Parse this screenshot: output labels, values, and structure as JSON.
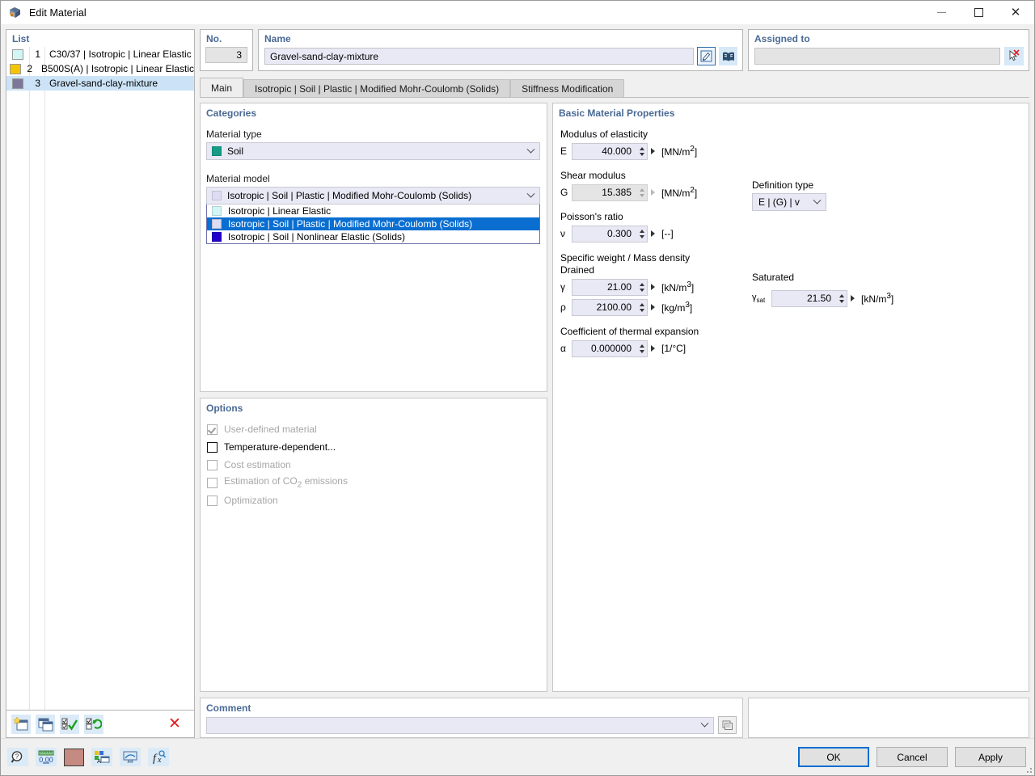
{
  "window": {
    "title": "Edit Material",
    "icon": "material-icon",
    "minimize": "minimize-icon",
    "maximize": "maximize-icon",
    "close": "close-icon"
  },
  "list": {
    "title": "List",
    "rows": [
      {
        "no": "1",
        "name": "C30/37 | Isotropic | Linear Elastic",
        "color": "#d2f6f6",
        "selected": false
      },
      {
        "no": "2",
        "name": "B500S(A) | Isotropic | Linear Elastic",
        "color": "#f5c400",
        "selected": false
      },
      {
        "no": "3",
        "name": "Gravel-sand-clay-mixture",
        "color": "#7d7899",
        "selected": true
      }
    ],
    "toolbar": [
      {
        "name": "new-material-button",
        "icon": "new-window-icon"
      },
      {
        "name": "copy-material-button",
        "icon": "copy-windows-icon"
      },
      {
        "name": "select-all-button",
        "icon": "checklist-check-icon"
      },
      {
        "name": "invert-selection-button",
        "icon": "checklist-refresh-icon"
      },
      {
        "name": "delete-material-button",
        "icon": "delete-x-icon"
      }
    ]
  },
  "no": {
    "title": "No.",
    "value": "3"
  },
  "name": {
    "title": "Name",
    "value": "Gravel-sand-clay-mixture",
    "edit_button": "edit-pencil-icon",
    "library_button": "material-library-icon"
  },
  "assigned": {
    "title": "Assigned to",
    "value": "",
    "pick_button": "select-objects-icon"
  },
  "tabs": [
    {
      "label": "Main",
      "active": true
    },
    {
      "label": "Isotropic | Soil | Plastic | Modified Mohr-Coulomb (Solids)",
      "active": false
    },
    {
      "label": "Stiffness Modification",
      "active": false
    }
  ],
  "categories": {
    "title": "Categories",
    "material_type_label": "Material type",
    "material_type_value": "Soil",
    "material_type_color": "#169b84",
    "material_model_label": "Material model",
    "material_model_value": "Isotropic | Soil | Plastic | Modified Mohr-Coulomb (Solids)",
    "material_model_color": "#dcdcf2",
    "material_model_options": [
      {
        "label": "Isotropic | Linear Elastic",
        "color": "#d2f6f6",
        "selected": false
      },
      {
        "label": "Isotropic | Soil | Plastic | Modified Mohr-Coulomb (Solids)",
        "color": "#dcdcf2",
        "selected": true
      },
      {
        "label": "Isotropic | Soil | Nonlinear Elastic (Solids)",
        "color": "#2200cc",
        "selected": false
      }
    ]
  },
  "options": {
    "title": "Options",
    "items": [
      {
        "label": "User-defined material",
        "checked": true,
        "enabled": false
      },
      {
        "label": "Temperature-dependent...",
        "checked": false,
        "enabled": true
      },
      {
        "label": "Cost estimation",
        "checked": false,
        "enabled": false
      },
      {
        "label": "Estimation of CO2 emissions",
        "checked": false,
        "enabled": false
      },
      {
        "label": "Optimization",
        "checked": false,
        "enabled": false
      }
    ]
  },
  "properties": {
    "title": "Basic Material Properties",
    "modulus_label": "Modulus of elasticity",
    "modulus": {
      "symbol": "E",
      "value": "40.000",
      "unit": "[MN/m2]",
      "enabled": true
    },
    "shear_label": "Shear modulus",
    "shear": {
      "symbol": "G",
      "value": "15.385",
      "unit": "[MN/m2]",
      "enabled": false
    },
    "definition_type_label": "Definition type",
    "definition_type_value": "E | (G) | v",
    "poisson_label": "Poisson's ratio",
    "poisson": {
      "symbol": "ν",
      "value": "0.300",
      "unit": "[--]",
      "enabled": true
    },
    "weight_label": "Specific weight / Mass density",
    "drained_label": "Drained",
    "saturated_label": "Saturated",
    "gamma": {
      "symbol": "γ",
      "value": "21.00",
      "unit": "[kN/m3]",
      "enabled": true
    },
    "rho": {
      "symbol": "ρ",
      "value": "2100.00",
      "unit": "[kg/m3]",
      "enabled": true
    },
    "gamma_sat": {
      "symbol": "γ",
      "sub": "sat",
      "value": "21.50",
      "unit": "[kN/m3]",
      "enabled": true
    },
    "thermal_label": "Coefficient of thermal expansion",
    "alpha": {
      "symbol": "α",
      "value": "0.000000",
      "unit": "[1/°C]",
      "enabled": true
    }
  },
  "comment": {
    "title": "Comment",
    "value": "",
    "dropdown_icon": "chevron-down-icon",
    "button_icon": "comment-list-icon"
  },
  "footer": {
    "tools": [
      {
        "name": "help-info-button",
        "icon": "question-magnifier-icon"
      },
      {
        "name": "units-button",
        "icon": "units-ruler-icon"
      },
      {
        "name": "color-button",
        "icon": "color-swatch-icon"
      },
      {
        "name": "display-properties-button",
        "icon": "display-properties-icon"
      },
      {
        "name": "view-settings-button",
        "icon": "screen-view-icon"
      },
      {
        "name": "parameters-button",
        "icon": "function-fx-icon"
      }
    ],
    "ok": "OK",
    "cancel": "Cancel",
    "apply": "Apply"
  }
}
